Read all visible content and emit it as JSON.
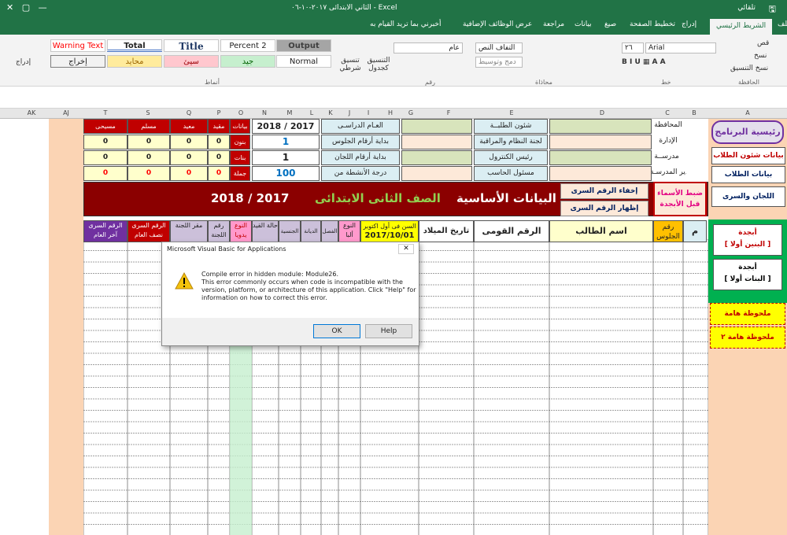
{
  "window": {
    "title": "الثاني الابتدائى ٢٠١٧-١٠-٠٦  -  Excel",
    "autosave": "تلقائي"
  },
  "tabs": [
    "ملف",
    "الشريط الرئيسي",
    "إدراج",
    "تخطيط الصفحة",
    "صيغ",
    "بيانات",
    "مراجعة",
    "عرض",
    "الوظائف الإضافية",
    "أخبرني بما تريد القيام به"
  ],
  "ribbon": {
    "clipboard": {
      "cut": "قص",
      "copy": "نسخ",
      "format_painter": "نسخ التنسيق",
      "group": "الحافظة"
    },
    "font": {
      "name": "Arial",
      "size": "٢٦",
      "group": "خط"
    },
    "alignment": {
      "wrap": "التفاف النص",
      "merge": "دمج وتوسيط",
      "group": "محاذاة"
    },
    "number": {
      "format": "عام",
      "group": "رقم"
    },
    "styles": {
      "cond": "تنسيق شرطي",
      "table": "التنسيق كجدول",
      "group": "أنماط",
      "cells": [
        "Warning Text",
        "Total",
        "Title",
        "Percent 2",
        "Output",
        "إخراج",
        "محايد",
        "سيئ",
        "جيد",
        "Normal"
      ]
    },
    "insert": "إدراج"
  },
  "columns": [
    "AK",
    "AJ",
    "T",
    "S",
    "Q",
    "P",
    "O",
    "N",
    "M",
    "L",
    "K",
    "J",
    "I",
    "H",
    "G",
    "F",
    "E",
    "D",
    "C",
    "B",
    "A"
  ],
  "sidebar": {
    "home": "رئيسية البرنامج",
    "students_affairs": "بيانات شئون الطلاب",
    "students": "بيانات الطلاب",
    "committees": "اللجان والسرى",
    "alpha_boys": "أبجدة",
    "alpha_boys2": "[ البنين أولا ]",
    "alpha_girls": "أبجدة",
    "alpha_girls2": "[ البنات أولا ]",
    "note1": "ملحوظة هامة",
    "note2": "ملحوظة هامة ٢"
  },
  "info": {
    "gov": "المحافظة",
    "admin": "الإدارة",
    "school": "مدرســة",
    "principal": "مدير المدرسـة",
    "affairs": "شئون الطلبــة",
    "order": "لجنة النظام والمراقبة",
    "control": "رئيس الكنترول",
    "pc": "مسئول الحاسب",
    "year_label": "العـام الدراسـى",
    "seat_start": "بداية أرقام الجلوس",
    "comm_start": "بداية أرقام اللجان",
    "activity": "درجة الأنشطة من",
    "year": "2018  /  2017",
    "seat_val": "1",
    "comm_val": "1",
    "activity_val": "100"
  },
  "stats": {
    "headers": [
      "مسيحى",
      "مسلم",
      "معيد",
      "مقيد",
      "بيانات"
    ],
    "rows": [
      {
        "label": "بنون",
        "vals": [
          "0",
          "0",
          "0",
          "0"
        ]
      },
      {
        "label": "بنات",
        "vals": [
          "0",
          "0",
          "0",
          "0"
        ]
      },
      {
        "label": "جملة",
        "vals": [
          "0",
          "0",
          "0",
          "0"
        ]
      }
    ]
  },
  "banner": {
    "title": "البيانات الأساسية",
    "grade": "الصف الثانى الابتدائى",
    "year": "2018  /  2017",
    "hide": "إخفاء الرقم السرى",
    "show": "إظهار الرقم السرى",
    "adjust": "ضبط الأسماء قبل الأبجدة"
  },
  "headers": {
    "m": "م",
    "seat": "رقم الجلوس",
    "name": "اسم الطالب",
    "national": "الرقم القومى",
    "birth": "تاريخ الميلاد",
    "age": "السن فى أول اكتوبر",
    "age_date": "2017/10/01",
    "type_alpha": "النوع ألبا",
    "class": "الفصل",
    "religion": "الديانة",
    "nationality": "الجنسية",
    "status": "حالة القيد",
    "type_manual": "النوع يدويا",
    "comm_no": "رقم اللجنة",
    "comm_hq": "مقر اللجنة",
    "secret_mid": "الرقم السرى نصف العام",
    "secret_end": "الرقم السرى آخر العام"
  },
  "dialog": {
    "title": "Microsoft Visual Basic for Applications",
    "line1": "Compile error in hidden module: Module26.",
    "line2": "This error commonly occurs when code is incompatible with the",
    "line3": "version, platform, or architecture of this application.  Click \"Help\" for",
    "line4": "information on how to correct this error.",
    "ok": "OK",
    "help": "Help",
    "close": "✕"
  }
}
